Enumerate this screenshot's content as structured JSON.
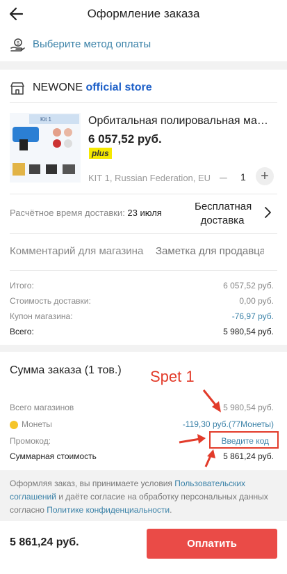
{
  "header": {
    "title": "Оформление заказа"
  },
  "payment": {
    "label": "Выберите метод оплаты"
  },
  "store": {
    "name_prefix": "NEWONE ",
    "name_highlight": "official store"
  },
  "product": {
    "name": "Орбитальная полировальная машин...",
    "price": "6 057,52 руб.",
    "badge": "plus",
    "variant": "KIT 1, Russian Federation, EU",
    "quantity": "1",
    "thumb_label": "Kit 1"
  },
  "delivery": {
    "label": "Расчётное время доставки: ",
    "date": "23 июля",
    "method_line1": "Бесплатная",
    "method_line2": "доставка"
  },
  "comment": {
    "label": "Комментарий для магазина",
    "placeholder": "Заметка для продавца"
  },
  "store_totals": [
    {
      "key": "Итого:",
      "value": "6 057,52 руб."
    },
    {
      "key": "Стоимость доставки:",
      "value": "0,00 руб."
    },
    {
      "key": "Купон магазина:",
      "value": "-76,97 руб."
    },
    {
      "key": "Всего:",
      "value": "5 980,54 руб."
    }
  ],
  "summary": {
    "title": "Сумма заказа (1 тов.)",
    "all_stores_label": "Всего магазинов",
    "all_stores_value": "5 980,54 руб.",
    "coins_label": "Монеты",
    "coins_value": "-119,30 руб.(77Монеты)",
    "promo_label": "Промокод:",
    "promo_link": "Введите код",
    "grand_label": "Суммарная стоимость",
    "grand_value": "5 861,24 руб."
  },
  "annotation": {
    "step_label": "Spet 1",
    "color": "#e23b2a"
  },
  "legal": {
    "part1": "Оформляя заказ, вы принимаете условия ",
    "link1": "Пользовательских соглашений",
    "part2": " и даёте согласие на обработку персональных данных согласно ",
    "link2": "Политике конфиденциальности",
    "part3": "."
  },
  "footer": {
    "total": "5 861,24 руб.",
    "pay_button": "Оплатить"
  },
  "colors": {
    "accent_blue": "#3b82a8",
    "store_blue": "#1e60c8",
    "pay_red": "#ea4b47",
    "plus_yellow": "#f5e800"
  }
}
